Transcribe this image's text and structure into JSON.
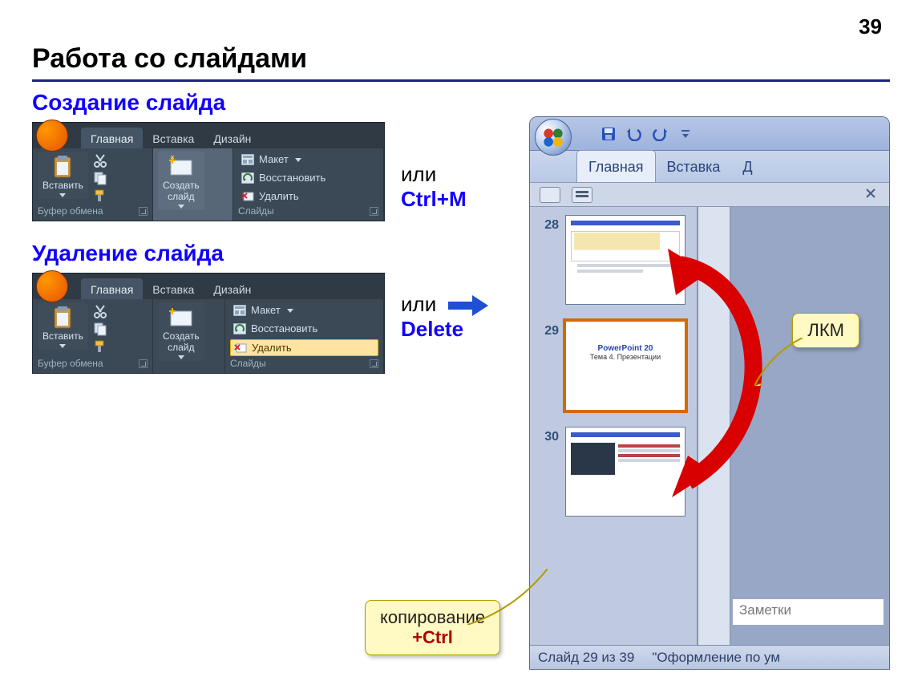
{
  "page_number": "39",
  "title": "Работа со слайдами",
  "section_create": "Создание слайда",
  "section_delete": "Удаление слайда",
  "or_text": "или",
  "shortcut_create": "Ctrl+M",
  "shortcut_delete": "Delete",
  "ribbon": {
    "tabs": {
      "home": "Главная",
      "insert": "Вставка",
      "design": "Дизайн"
    },
    "paste": "Вставить",
    "clipboard_group": "Буфер обмена",
    "new_slide": "Создать\nслайд",
    "layout": "Макет",
    "reset": "Восстановить",
    "delete": "Удалить",
    "slides_group": "Слайды"
  },
  "ppwindow": {
    "tabs": {
      "home": "Главная",
      "insert": "Вставка",
      "design_trunc": "Д"
    },
    "slide28": "28",
    "slide29": "29",
    "slide30": "30",
    "slide29_title": "PowerPoint 20",
    "slide29_sub": "Тема 4. Презентации",
    "notes_placeholder": "Заметки",
    "status_slide": "Слайд 29 из 39",
    "status_theme": "\"Оформление по ум"
  },
  "callouts": {
    "lmb": "ЛКМ",
    "copy_line1": "копирование",
    "copy_line2": "+Ctrl"
  }
}
